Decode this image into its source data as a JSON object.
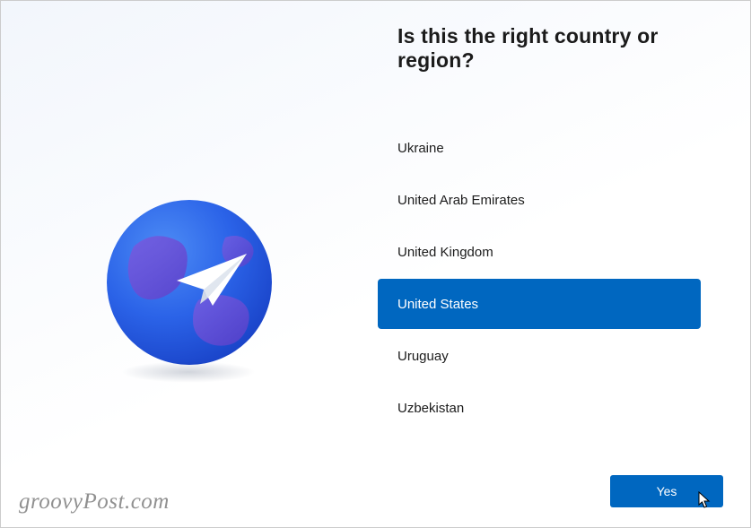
{
  "title": "Is this the right country or region?",
  "countries": [
    {
      "label": "Ukraine",
      "selected": false
    },
    {
      "label": "United Arab Emirates",
      "selected": false
    },
    {
      "label": "United Kingdom",
      "selected": false
    },
    {
      "label": "United States",
      "selected": true
    },
    {
      "label": "Uruguay",
      "selected": false
    },
    {
      "label": "Uzbekistan",
      "selected": false
    }
  ],
  "confirm_label": "Yes",
  "watermark": "groovyPost.com",
  "colors": {
    "accent": "#0067c0",
    "globe_light": "#3a7bf0",
    "globe_dark": "#1b4fd6",
    "land": "#6a4ed6"
  }
}
